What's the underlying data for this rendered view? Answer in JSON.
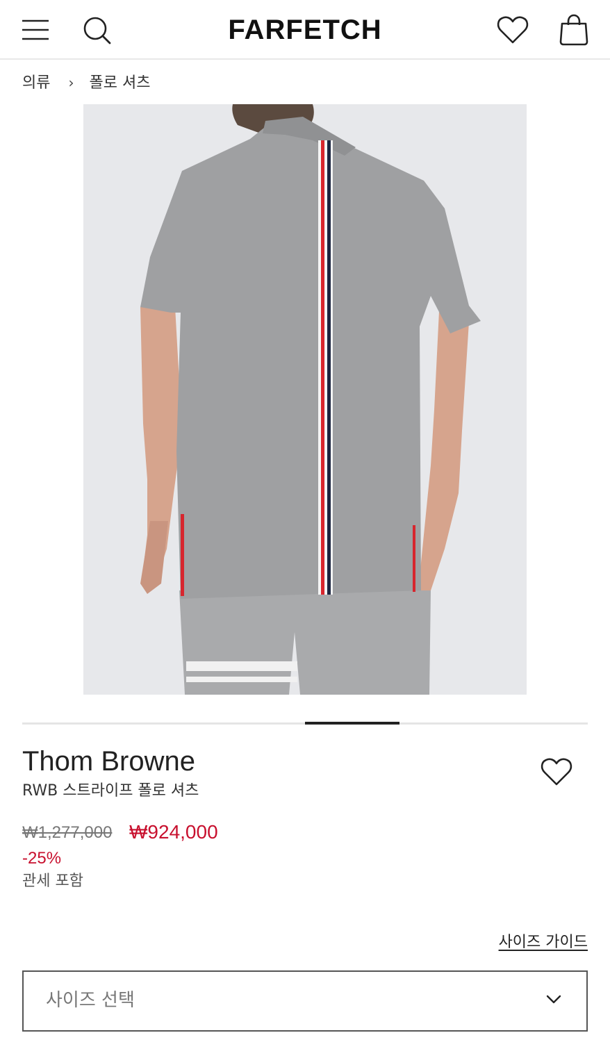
{
  "header": {
    "logo": "FARFETCH"
  },
  "breadcrumb": {
    "items": [
      "의류",
      "폴로 셔츠"
    ],
    "separator": "›"
  },
  "carousel": {
    "current_index": 4,
    "slide_count": 6
  },
  "product": {
    "brand": "Thom Browne",
    "name": "RWB 스트라이프 폴로 셔츠",
    "original_price": "₩1,277,000",
    "sale_price": "₩924,000",
    "discount": "-25%",
    "duty_note": "관세 포함"
  },
  "size": {
    "guide_label": "사이즈 가이드",
    "select_placeholder": "사이즈 선택"
  },
  "colors": {
    "sale_red": "#c8102e",
    "stripe_red": "#d7262e",
    "stripe_navy": "#1b2540",
    "shirt_gray": "#9fa0a2"
  },
  "icons": {
    "menu": "menu-icon",
    "search": "search-icon",
    "wishlist": "heart-icon",
    "bag": "shopping-bag-icon",
    "dropdown": "chevron-down-icon"
  }
}
